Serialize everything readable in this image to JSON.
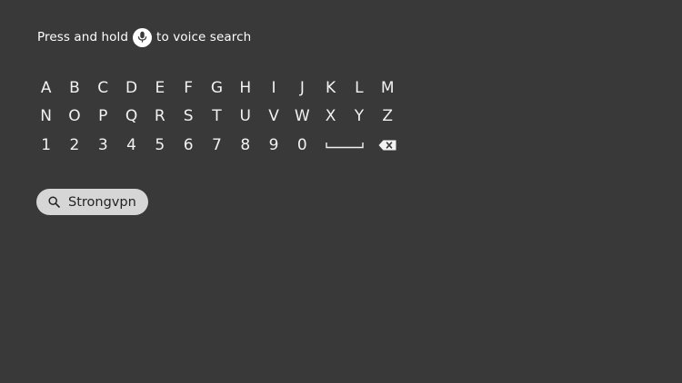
{
  "voice_hint": {
    "before": "Press and hold",
    "icon": "microphone-icon",
    "after": "to voice search"
  },
  "keyboard": {
    "rows": [
      [
        "A",
        "B",
        "C",
        "D",
        "E",
        "F",
        "G",
        "H",
        "I",
        "J",
        "K",
        "L",
        "M"
      ],
      [
        "N",
        "O",
        "P",
        "Q",
        "R",
        "S",
        "T",
        "U",
        "V",
        "W",
        "X",
        "Y",
        "Z"
      ],
      [
        "1",
        "2",
        "3",
        "4",
        "5",
        "6",
        "7",
        "8",
        "9",
        "0"
      ]
    ],
    "special_keys": [
      "space-icon",
      "backspace-icon"
    ]
  },
  "suggestion": {
    "icon": "search-icon",
    "label": "Strongvpn"
  },
  "colors": {
    "background": "#393939",
    "text": "#ffffff",
    "chip_background": "#d6d6d6",
    "chip_text": "#232323"
  }
}
